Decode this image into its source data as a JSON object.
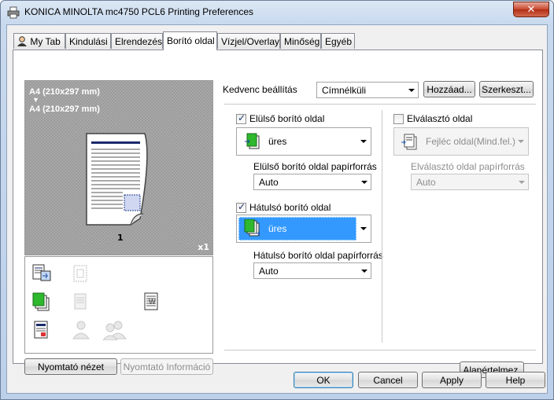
{
  "window": {
    "title": "KONICA MINOLTA mc4750 PCL6 Printing Preferences",
    "close_glyph": "✕"
  },
  "tabs": [
    {
      "label": "My Tab"
    },
    {
      "label": "Kindulási"
    },
    {
      "label": "Elrendezés"
    },
    {
      "label": "Borító oldal"
    },
    {
      "label": "Vízjel/Overlay"
    },
    {
      "label": "Minőség"
    },
    {
      "label": "Egyéb"
    }
  ],
  "preview": {
    "line1": "A4 (210x297 mm)",
    "arrow": "▼",
    "line2": "A4 (210x297 mm)",
    "page_number": "1",
    "copies": "x1"
  },
  "left_buttons": {
    "printer_view": "Nyomtató nézet",
    "printer_info": "Nyomtató Információ"
  },
  "favorites": {
    "label": "Kedvenc beállítás",
    "value": "Címnélküli",
    "add_button": "Hozzáad...",
    "edit_button": "Szerkeszt..."
  },
  "front_cover": {
    "checkbox_label": "Elülső borító oldal",
    "checked": true,
    "value": "üres",
    "tray_label": "Elülső borító oldal papírforrás",
    "tray_value": "Auto"
  },
  "back_cover": {
    "checkbox_label": "Hátulsó borító oldal",
    "checked": true,
    "value": "üres",
    "tray_label": "Hátulsó borító oldal papírforrás",
    "tray_value": "Auto"
  },
  "separator": {
    "checkbox_label": "Elválasztó oldal",
    "checked": false,
    "value": "Fejléc oldal(Mind.fel.)",
    "tray_label": "Elválasztó oldal papírforrás",
    "tray_value": "Auto"
  },
  "defaults_button": "Alapértelmez.",
  "footer": {
    "ok": "OK",
    "cancel": "Cancel",
    "apply": "Apply",
    "help": "Help"
  },
  "icons": {
    "title": "printer-icon",
    "my_tab": "user-icon"
  },
  "colors": {
    "selection": "#3399ff",
    "title_close": "#c7462e"
  }
}
